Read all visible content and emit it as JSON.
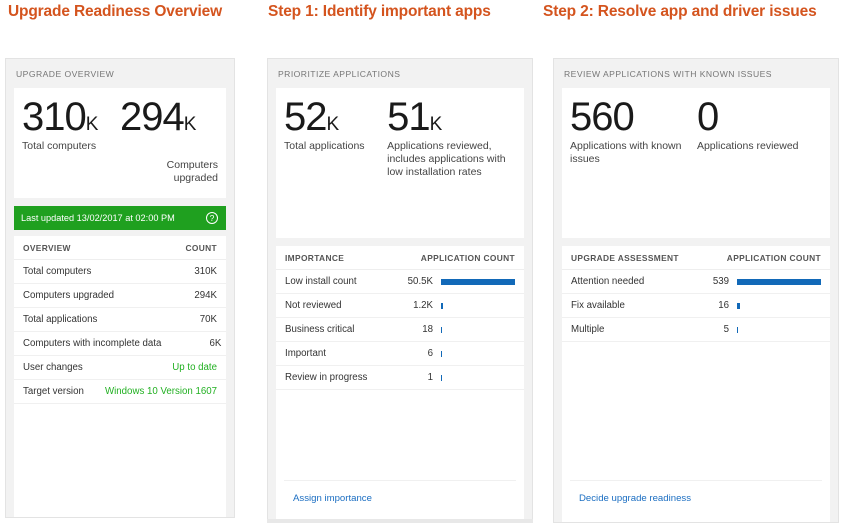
{
  "headings": {
    "col1": "Upgrade Readiness Overview",
    "col2": "Step 1: Identify important apps",
    "col3": "Step 2: Resolve app and driver issues"
  },
  "colors": {
    "heading": "#d4541e",
    "status_banner": "#1fa01f",
    "bar": "#1269b8",
    "link": "#1b6ec2",
    "positive_text": "#22b022"
  },
  "card_overview": {
    "title": "UPGRADE OVERVIEW",
    "kpis": [
      {
        "value": "310",
        "suffix": "K",
        "label": "Total computers"
      },
      {
        "value": "294",
        "suffix": "K",
        "label": "Computers upgraded"
      }
    ],
    "status": {
      "text": "Last updated 13/02/2017 at 02:00 PM",
      "help_icon": "?"
    },
    "table": {
      "header_label": "OVERVIEW",
      "header_value": "COUNT",
      "rows": [
        {
          "label": "Total computers",
          "value": "310K",
          "highlight": false
        },
        {
          "label": "Computers upgraded",
          "value": "294K",
          "highlight": false
        },
        {
          "label": "Total applications",
          "value": "70K",
          "highlight": false
        },
        {
          "label": "Computers with incomplete data",
          "value": "6K",
          "highlight": false
        },
        {
          "label": "User changes",
          "value": "Up to date",
          "highlight": true
        },
        {
          "label": "Target version",
          "value": "Windows 10 Version 1607",
          "highlight": true
        }
      ]
    }
  },
  "card_prioritize": {
    "title": "PRIORITIZE APPLICATIONS",
    "kpis": [
      {
        "value": "52",
        "suffix": "K",
        "label": "Total applications"
      },
      {
        "value": "51",
        "suffix": "K",
        "label": "Applications reviewed, includes applications with low installation rates"
      }
    ],
    "table": {
      "header_label": "IMPORTANCE",
      "header_value": "APPLICATION COUNT",
      "rows": [
        {
          "label": "Low install count",
          "value": "50.5K",
          "bar_pct": 100
        },
        {
          "label": "Not reviewed",
          "value": "1.2K",
          "bar_pct": 2.4
        },
        {
          "label": "Business critical",
          "value": "18",
          "bar_pct": 1.2
        },
        {
          "label": "Important",
          "value": "6",
          "bar_pct": 1.2
        },
        {
          "label": "Review in progress",
          "value": "1",
          "bar_pct": 1.2
        }
      ]
    },
    "footer_link": "Assign importance"
  },
  "card_review": {
    "title": "REVIEW APPLICATIONS WITH KNOWN ISSUES",
    "kpis": [
      {
        "value": "560",
        "suffix": "",
        "label": "Applications with known issues"
      },
      {
        "value": "0",
        "suffix": "",
        "label": "Applications reviewed"
      }
    ],
    "table": {
      "header_label": "UPGRADE ASSESSMENT",
      "header_value": "APPLICATION COUNT",
      "rows": [
        {
          "label": "Attention needed",
          "value": "539",
          "bar_pct": 100
        },
        {
          "label": "Fix available",
          "value": "16",
          "bar_pct": 4
        },
        {
          "label": "Multiple",
          "value": "5",
          "bar_pct": 1.5
        }
      ]
    },
    "footer_link": "Decide upgrade readiness"
  },
  "chart_data": [
    {
      "type": "bar",
      "title": "PRIORITIZE APPLICATIONS",
      "xlabel": "APPLICATION COUNT",
      "ylabel": "IMPORTANCE",
      "categories": [
        "Low install count",
        "Not reviewed",
        "Business critical",
        "Important",
        "Review in progress"
      ],
      "values": [
        50500,
        1200,
        18,
        6,
        1
      ],
      "value_labels": [
        "50.5K",
        "1.2K",
        "18",
        "6",
        "1"
      ],
      "orientation": "horizontal",
      "grid": false,
      "legend": "none"
    },
    {
      "type": "bar",
      "title": "REVIEW APPLICATIONS WITH KNOWN ISSUES",
      "xlabel": "APPLICATION COUNT",
      "ylabel": "UPGRADE ASSESSMENT",
      "categories": [
        "Attention needed",
        "Fix available",
        "Multiple"
      ],
      "values": [
        539,
        16,
        5
      ],
      "value_labels": [
        "539",
        "16",
        "5"
      ],
      "orientation": "horizontal",
      "grid": false,
      "legend": "none"
    }
  ]
}
